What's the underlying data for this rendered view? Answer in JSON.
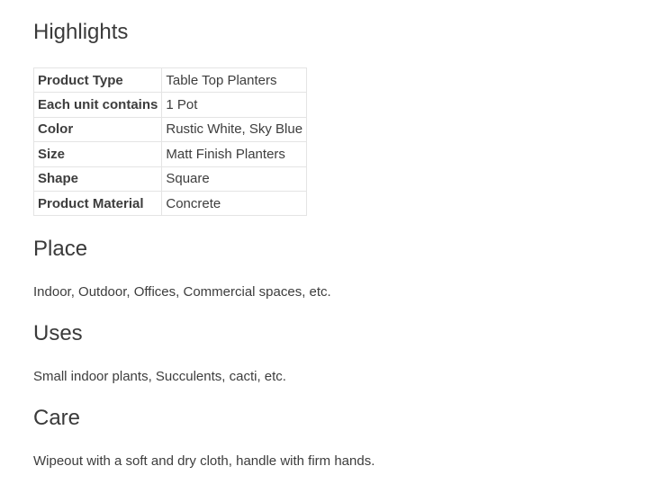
{
  "highlights": {
    "title": "Highlights",
    "rows": [
      {
        "label": "Product Type",
        "value": "Table Top Planters"
      },
      {
        "label": "Each unit contains",
        "value": "1 Pot"
      },
      {
        "label": "Color",
        "value": "Rustic White, Sky Blue"
      },
      {
        "label": "Size",
        "value": "Matt Finish Planters"
      },
      {
        "label": "Shape",
        "value": "Square"
      },
      {
        "label": "Product Material",
        "value": "Concrete"
      }
    ]
  },
  "place": {
    "title": "Place",
    "text": "Indoor, Outdoor, Offices, Commercial spaces, etc."
  },
  "uses": {
    "title": "Uses",
    "text": "Small indoor plants, Succulents, cacti, etc."
  },
  "care": {
    "title": "Care",
    "text": "Wipeout with a soft and dry cloth, handle with firm hands."
  }
}
